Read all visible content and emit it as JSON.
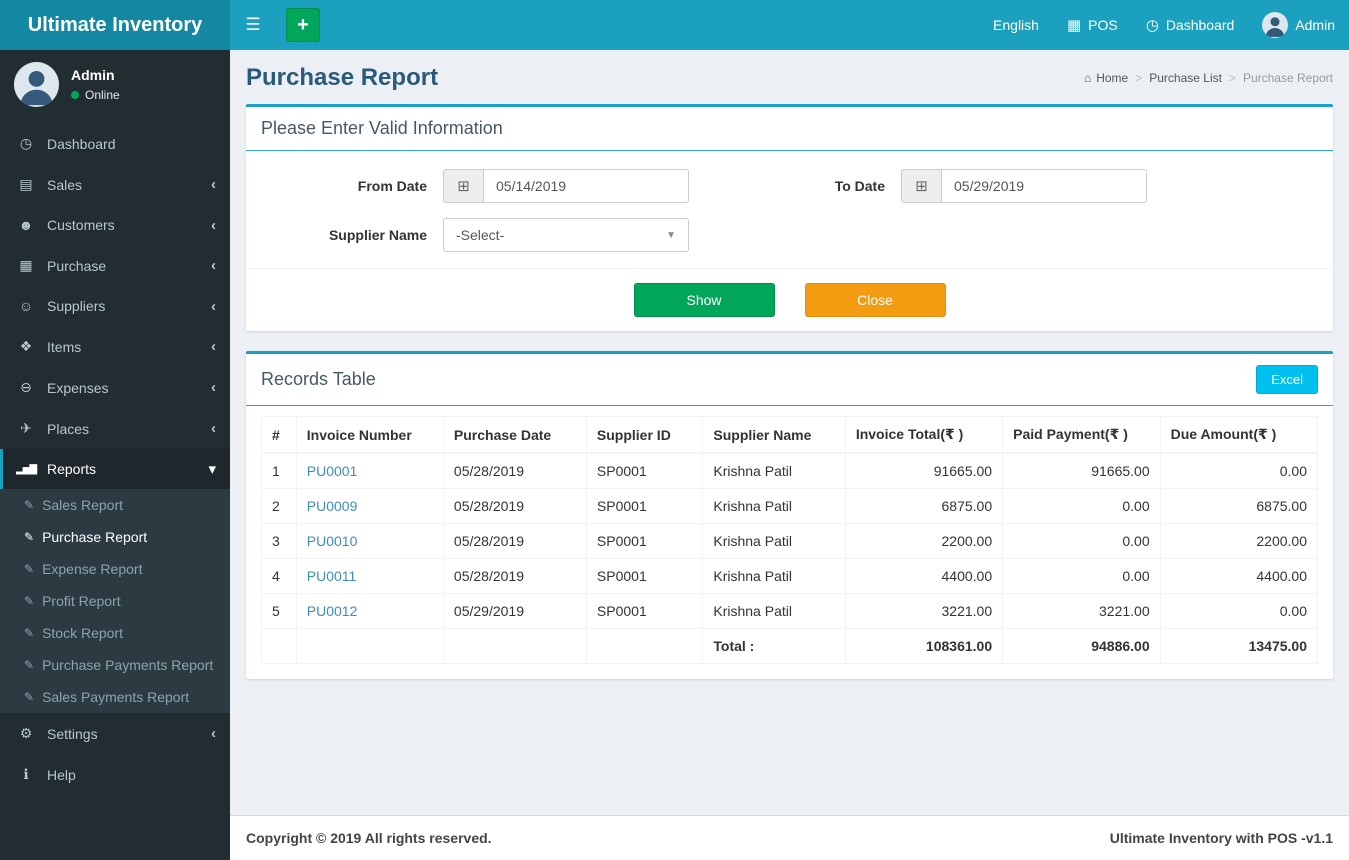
{
  "colors": {
    "navbar": "#1ba0bf",
    "brand_bg": "#1487a3",
    "sidebar_bg": "#222d32",
    "submenu_bg": "#2c3b41",
    "green": "#00a65a",
    "orange": "#f39c12",
    "info_cyan": "#00c0ef",
    "link_blue": "#3c8dbc",
    "page_bg": "#ecf0f5"
  },
  "icons": {
    "hamburger": "☰",
    "plus": "+",
    "pos": "▦",
    "dashboard_top": "◷",
    "home": "⌂",
    "calendar": "⊞",
    "caret_down": "▼",
    "report_item": "✎"
  },
  "topbar": {
    "brand": "Ultimate Inventory",
    "language": "English",
    "pos": "POS",
    "dashboard": "Dashboard",
    "user": "Admin"
  },
  "sidebar": {
    "user": {
      "name": "Admin",
      "status": "Online"
    },
    "menu": [
      {
        "label": "Dashboard",
        "icon": "◷",
        "chevron": ""
      },
      {
        "label": "Sales",
        "icon": "▤",
        "chevron": "‹"
      },
      {
        "label": "Customers",
        "icon": "☻",
        "chevron": "‹"
      },
      {
        "label": "Purchase",
        "icon": "▦",
        "chevron": "‹"
      },
      {
        "label": "Suppliers",
        "icon": "☺",
        "chevron": "‹"
      },
      {
        "label": "Items",
        "icon": "❖",
        "chevron": "‹"
      },
      {
        "label": "Expenses",
        "icon": "⊖",
        "chevron": "‹"
      },
      {
        "label": "Places",
        "icon": "✈",
        "chevron": "‹"
      },
      {
        "label": "Reports",
        "icon": "▂▅▇",
        "chevron": "▾"
      },
      {
        "label": "Settings",
        "icon": "⚙",
        "chevron": "‹"
      },
      {
        "label": "Help",
        "icon": "ℹ",
        "chevron": ""
      }
    ],
    "reports_submenu": [
      {
        "label": "Sales Report"
      },
      {
        "label": "Purchase Report"
      },
      {
        "label": "Expense Report"
      },
      {
        "label": "Profit Report"
      },
      {
        "label": "Stock Report"
      },
      {
        "label": "Purchase Payments Report"
      },
      {
        "label": "Sales Payments Report"
      }
    ]
  },
  "page": {
    "title": "Purchase Report",
    "breadcrumb": {
      "home": "Home",
      "parent": "Purchase List",
      "current": "Purchase Report",
      "sep": ">"
    }
  },
  "filter_card": {
    "title": "Please Enter Valid Information",
    "from_date_label": "From Date",
    "from_date_value": "05/14/2019",
    "to_date_label": "To Date",
    "to_date_value": "05/29/2019",
    "supplier_label": "Supplier Name",
    "supplier_value": "-Select-",
    "show_button": "Show",
    "close_button": "Close"
  },
  "records_card": {
    "title": "Records Table",
    "excel_button": "Excel",
    "table": {
      "headers": [
        "#",
        "Invoice Number",
        "Purchase Date",
        "Supplier ID",
        "Supplier Name",
        "Invoice Total(₹ )",
        "Paid Payment(₹ )",
        "Due Amount(₹ )"
      ],
      "rows": [
        [
          "1",
          "PU0001",
          "05/28/2019",
          "SP0001",
          "Krishna Patil",
          "91665.00",
          "91665.00",
          "0.00"
        ],
        [
          "2",
          "PU0009",
          "05/28/2019",
          "SP0001",
          "Krishna Patil",
          "6875.00",
          "0.00",
          "6875.00"
        ],
        [
          "3",
          "PU0010",
          "05/28/2019",
          "SP0001",
          "Krishna Patil",
          "2200.00",
          "0.00",
          "2200.00"
        ],
        [
          "4",
          "PU0011",
          "05/28/2019",
          "SP0001",
          "Krishna Patil",
          "4400.00",
          "0.00",
          "4400.00"
        ],
        [
          "5",
          "PU0012",
          "05/29/2019",
          "SP0001",
          "Krishna Patil",
          "3221.00",
          "3221.00",
          "0.00"
        ]
      ],
      "total_label": "Total :",
      "totals": [
        "108361.00",
        "94886.00",
        "13475.00"
      ]
    }
  },
  "footer": {
    "left": "Copyright © 2019 All rights reserved.",
    "right": "Ultimate Inventory with POS -v1.1"
  }
}
